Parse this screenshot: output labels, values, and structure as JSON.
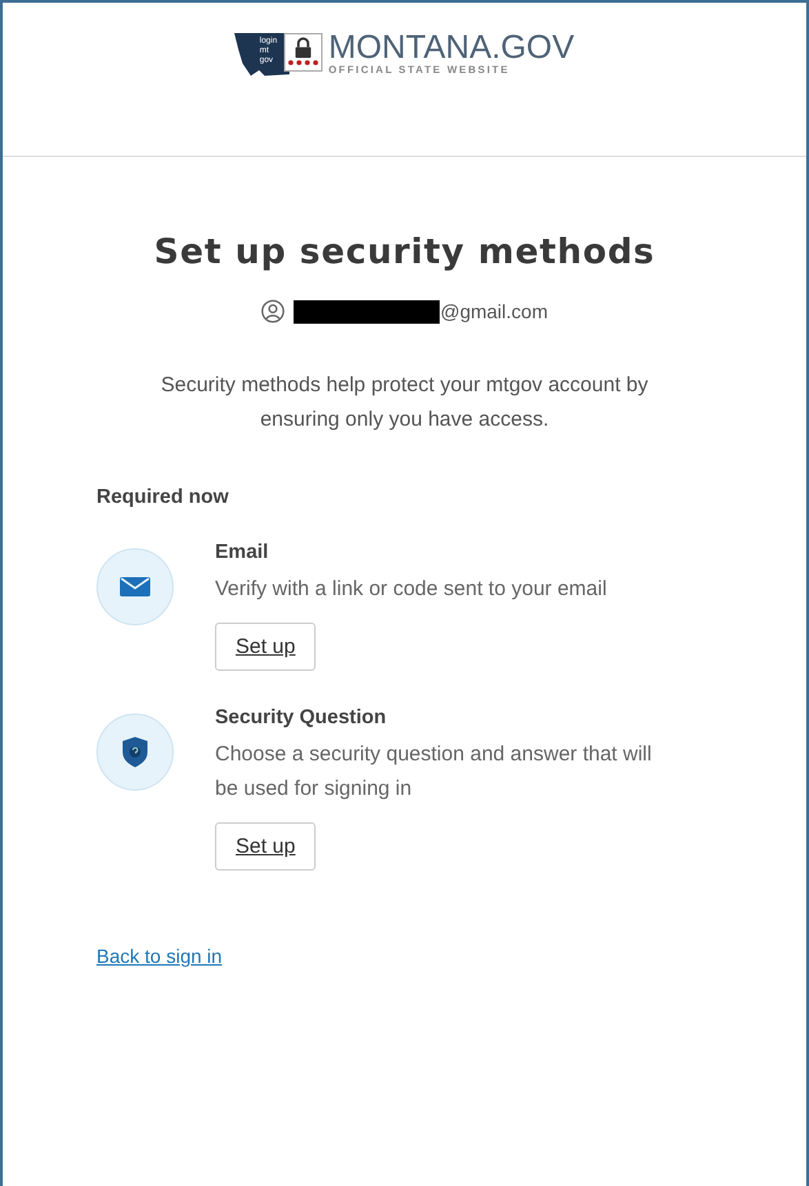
{
  "logo": {
    "badge_lines": [
      "login",
      "mt",
      "gov"
    ],
    "name": "MONTANA.GOV",
    "tagline": "OFFICIAL STATE WEBSITE"
  },
  "title": "Set up security methods",
  "account": {
    "email": "@gmail.com",
    "redacted": true
  },
  "intro": "Security methods help protect your mtgov account by ensuring only you have access.",
  "section_label": "Required now",
  "methods": [
    {
      "kind": "email",
      "title": "Email",
      "description": "Verify with a link or code sent to your email",
      "button": "Set up"
    },
    {
      "kind": "question",
      "title": "Security Question",
      "description": "Choose a security question and answer that will be used for signing in",
      "button": "Set up"
    }
  ],
  "back_link": "Back to sign in"
}
